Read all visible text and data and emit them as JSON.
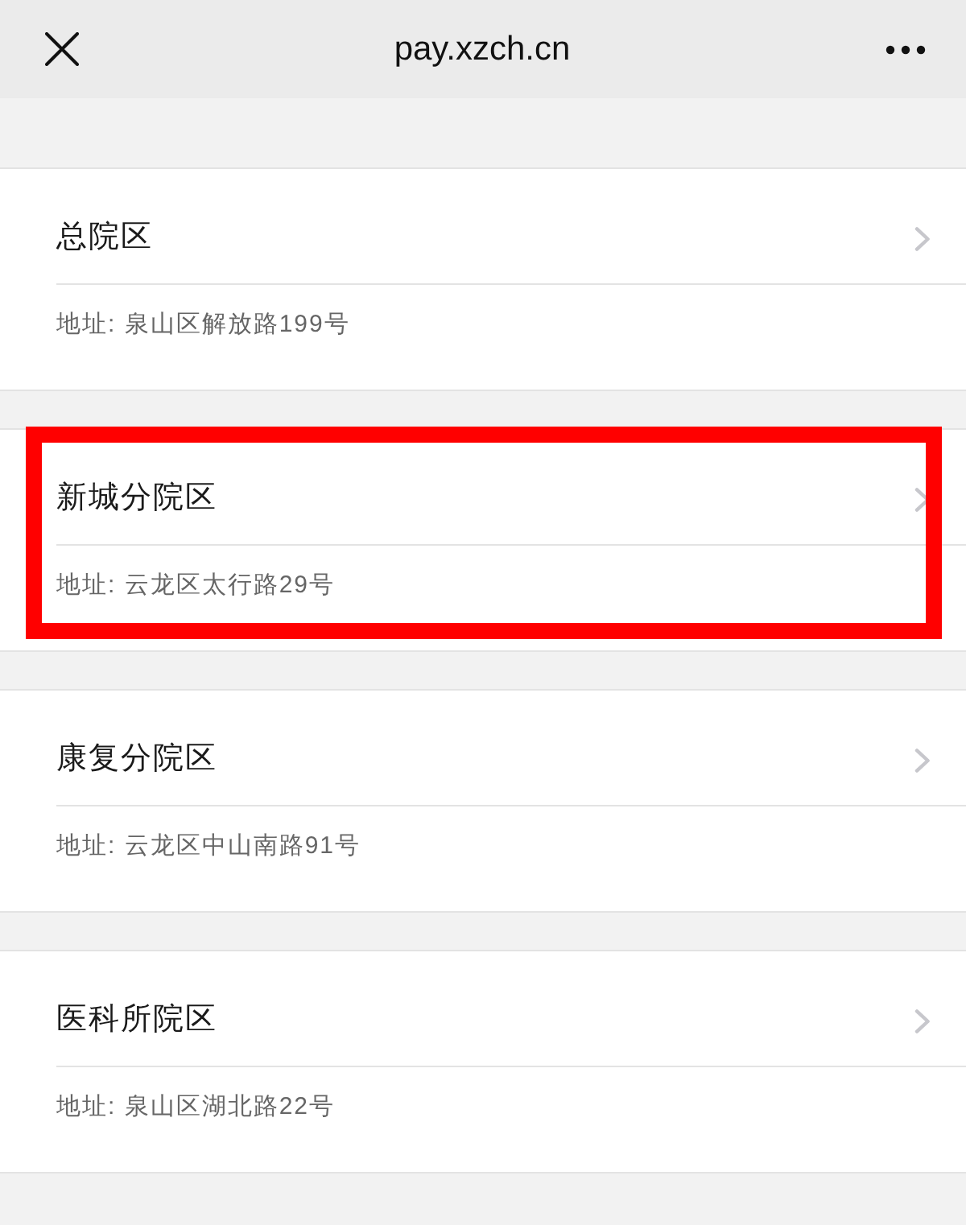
{
  "header": {
    "title": "pay.xzch.cn"
  },
  "campuses": [
    {
      "name": "总院区",
      "address": "地址: 泉山区解放路199号",
      "highlighted": false
    },
    {
      "name": "新城分院区",
      "address": "地址: 云龙区太行路29号",
      "highlighted": true
    },
    {
      "name": "康复分院区",
      "address": "地址: 云龙区中山南路91号",
      "highlighted": false
    },
    {
      "name": "医科所院区",
      "address": "地址: 泉山区湖北路22号",
      "highlighted": false
    }
  ]
}
